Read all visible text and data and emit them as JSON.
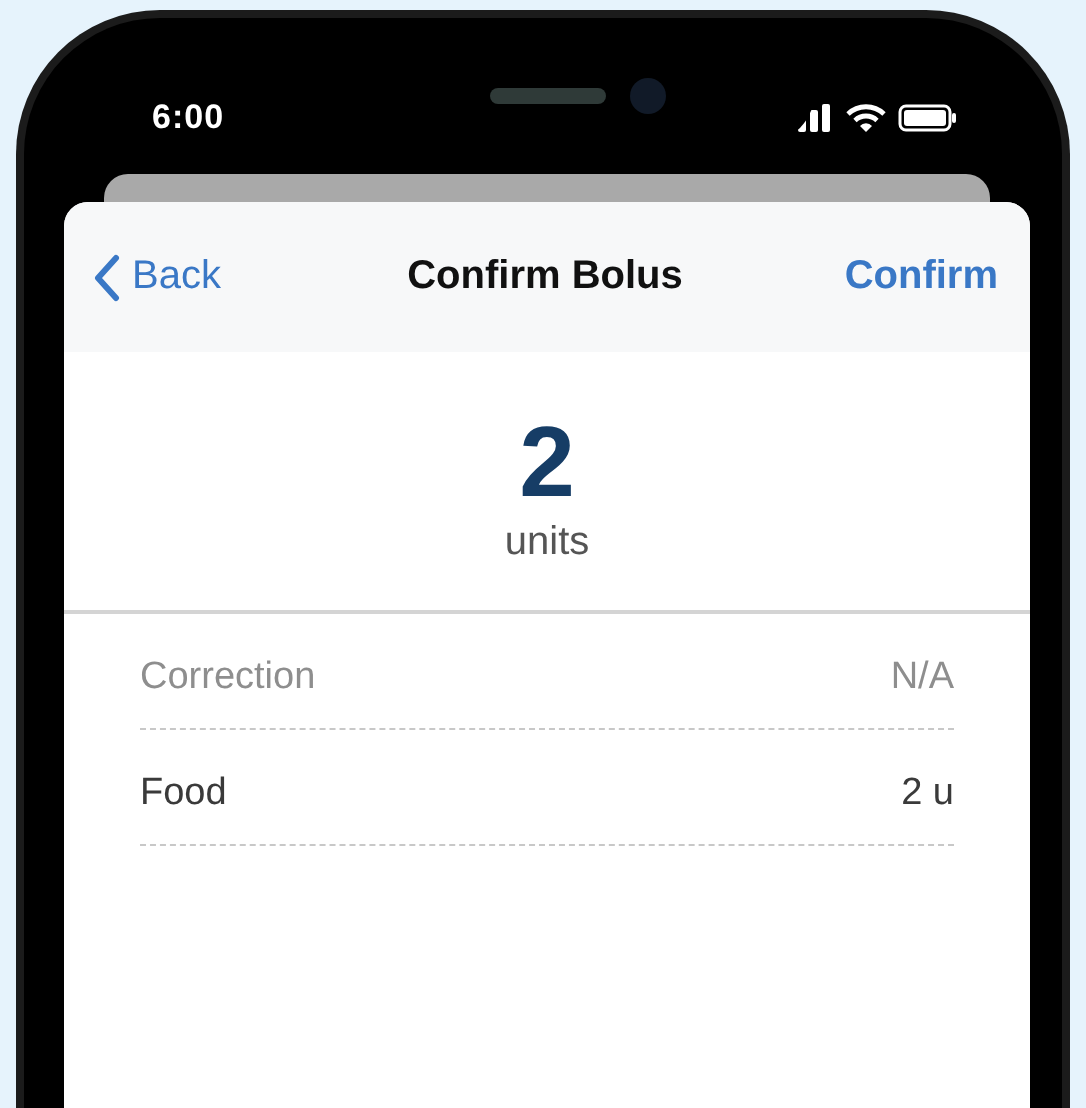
{
  "status_bar": {
    "time": "6:00"
  },
  "nav": {
    "back": "Back",
    "title": "Confirm Bolus",
    "action": "Confirm"
  },
  "bolus": {
    "amount": "2",
    "unit": "units"
  },
  "rows": [
    {
      "label": "Correction",
      "value": "N/A",
      "disabled": true
    },
    {
      "label": "Food",
      "value": "2 u",
      "disabled": false
    }
  ]
}
